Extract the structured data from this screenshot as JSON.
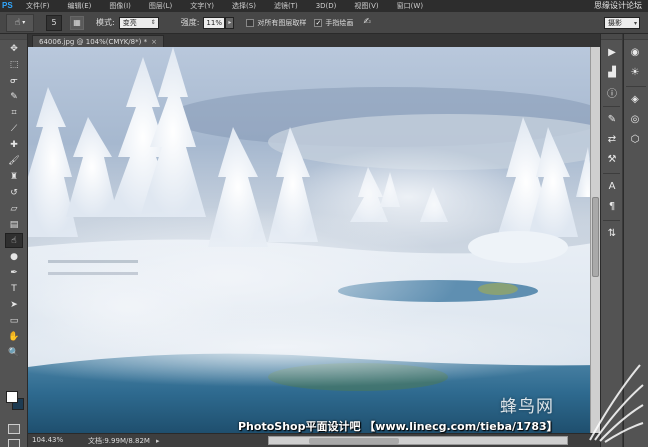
{
  "app": {
    "logo": "PS"
  },
  "menu": {
    "items": [
      "文件(F)",
      "编辑(E)",
      "图像(I)",
      "图层(L)",
      "文字(Y)",
      "选择(S)",
      "滤镜(T)",
      "3D(D)",
      "视图(V)",
      "窗口(W)"
    ],
    "watermark": "思缘设计论坛"
  },
  "options": {
    "tool_icon": "smudge-icon",
    "brush_size": "5",
    "mode_label": "模式:",
    "mode_value": "变亮",
    "strength_label": "强度:",
    "strength_value": "11%",
    "sample_all_layers_label": "对所有图层取样",
    "sample_all_layers_checked": false,
    "finger_painting_label": "手指绘画",
    "finger_painting_checked": true,
    "workspace_value": "摄影"
  },
  "document": {
    "tab_title": "64006.jpg @ 104%(CMYK/8*) *",
    "close_glyph": "×"
  },
  "status": {
    "zoom": "104.43%",
    "doc_size": "文档:9.99M/8.82M"
  },
  "overlay": {
    "caption": "PhotoShop平面设计吧 【www.linecg.com/tieba/1783】",
    "brand": "蜂鸟网"
  },
  "colors": {
    "foreground": "#ffffff",
    "background": "#1d3b52",
    "accent": "#31a8ff"
  },
  "tools": [
    "move-tool-icon",
    "marquee-tool-icon",
    "lasso-tool-icon",
    "quick-select-tool-icon",
    "crop-tool-icon",
    "eyedropper-tool-icon",
    "healing-brush-tool-icon",
    "brush-tool-icon",
    "clone-stamp-tool-icon",
    "history-brush-tool-icon",
    "eraser-tool-icon",
    "gradient-tool-icon",
    "smudge-tool-icon",
    "dodge-tool-icon",
    "pen-tool-icon",
    "type-tool-icon",
    "path-select-tool-icon",
    "shape-tool-icon",
    "hand-tool-icon",
    "zoom-tool-icon"
  ],
  "dock_left": [
    "play-icon",
    "histogram-icon",
    "info-icon",
    "brush-preset-icon",
    "clone-source-icon",
    "tool-preset-icon",
    "character-icon",
    "paragraph-icon",
    "swatches-icon"
  ],
  "dock_right": [
    "color-icon",
    "adjustments-icon",
    "layers-icon",
    "channels-icon",
    "paths-icon"
  ]
}
